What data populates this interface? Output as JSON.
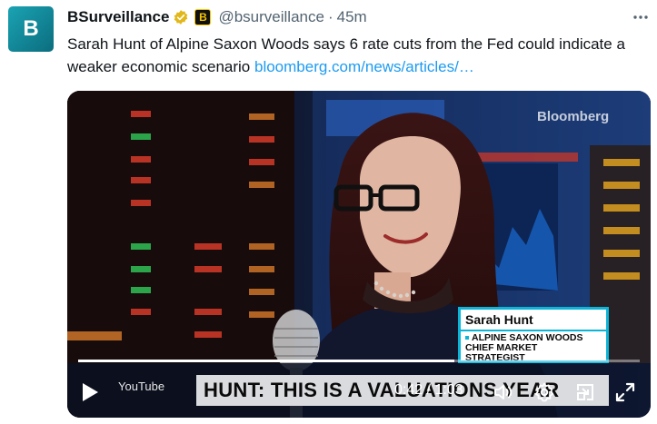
{
  "author": {
    "avatar_letter": "B",
    "display_name": "BSurveillance",
    "handle": "@bsurveillance",
    "separator": "·",
    "time": "45m",
    "affiliate_badge": "B"
  },
  "tweet": {
    "text": "Sarah Hunt of Alpine Saxon Woods says 6 rate cuts from the Fed could indicate a weaker economic scenario ",
    "link_text": "bloomberg.com/news/articles/…"
  },
  "video": {
    "watermark": "Bloomberg",
    "lower_third_name": "Sarah Hunt",
    "lower_third_title": "ALPINE SAXON WOODS\nCHIEF MARKET\nSTRATEGIST",
    "ticker_text": "HUNT: THIS IS A VALUATIONS YEAR",
    "source_label": "YouTube",
    "timecode": "0:42 / 1:03",
    "progress_fraction": 0.67
  },
  "icons": {
    "more": "more-horizontal-icon",
    "verified": "verified-badge-icon",
    "play": "play-icon",
    "volume": "volume-icon",
    "settings": "gear-icon",
    "pip": "picture-in-picture-icon",
    "fullscreen": "fullscreen-icon"
  },
  "colors": {
    "link": "#1d9bf0",
    "verified_gold": "#e2b719",
    "lower_third_accent": "#0bb5d8"
  }
}
